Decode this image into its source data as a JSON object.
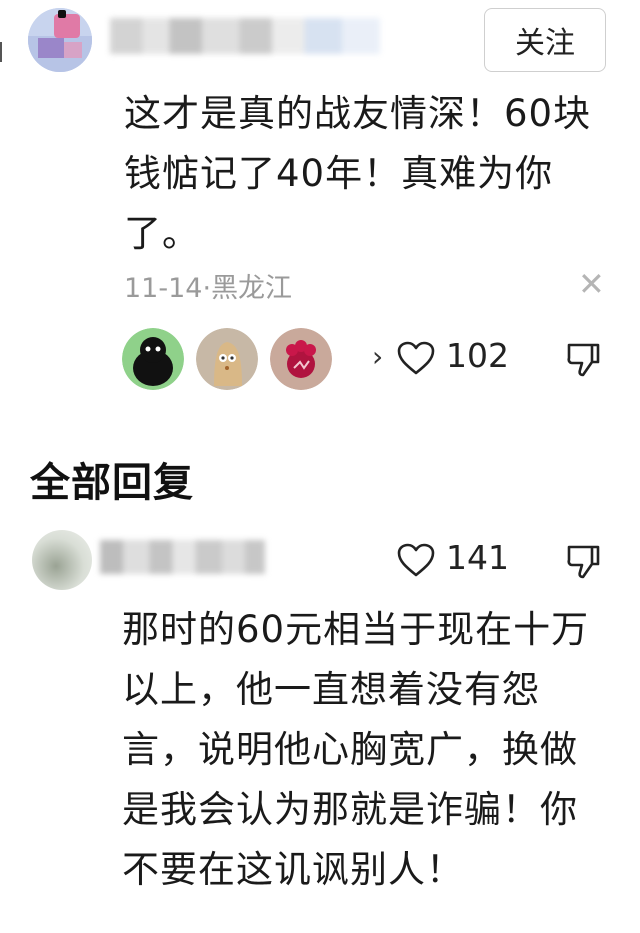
{
  "comment": {
    "follow_label": "关注",
    "text": "这才是真的战友情深！60块钱惦记了40年！真难为你了。",
    "date": "11-14",
    "separator": "·",
    "location": "黑龙江",
    "close_glyph": "✕",
    "reactions_more": "›",
    "like_count": "102"
  },
  "replies_section": {
    "title": "全部回复"
  },
  "reply": {
    "like_count": "141",
    "text": "那时的60元相当于现在十万以上，他一直想着没有怨言，说明他心胸宽广，换做是我会认为那就是诈骗！你不要在这讥讽别人！"
  },
  "icons": {
    "like": "heart-icon",
    "dislike": "thumb-down-icon",
    "close": "close-icon"
  }
}
